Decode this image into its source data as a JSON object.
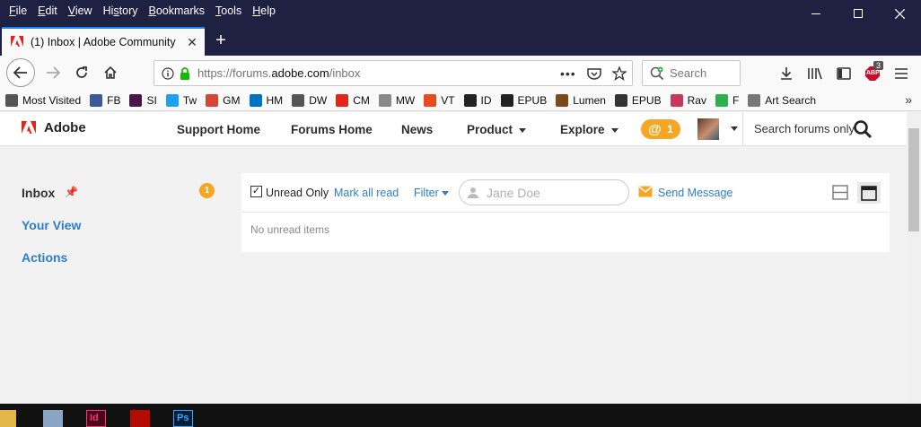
{
  "menu": [
    "File",
    "Edit",
    "View",
    "History",
    "Bookmarks",
    "Tools",
    "Help"
  ],
  "menu_underline": [
    "F",
    "E",
    "V",
    "s",
    "B",
    "T",
    "H"
  ],
  "tab": {
    "title": "(1) Inbox | Adobe Community"
  },
  "url": {
    "prefix": "https://forums.",
    "domain": "adobe.com",
    "path": "/inbox"
  },
  "search": {
    "placeholder": "Search"
  },
  "bookmarks": [
    {
      "label": "Most Visited",
      "icon": "gear-icon",
      "color": "#555555"
    },
    {
      "label": "FB",
      "icon": "facebook-icon",
      "color": "#3b5998"
    },
    {
      "label": "SI",
      "icon": "slack-icon",
      "color": "#4a154b"
    },
    {
      "label": "Tw",
      "icon": "twitter-icon",
      "color": "#1da1f2"
    },
    {
      "label": "GM",
      "icon": "gmail-icon",
      "color": "#d44638"
    },
    {
      "label": "HM",
      "icon": "outlook-icon",
      "color": "#0072c6"
    },
    {
      "label": "DW",
      "icon": "dw-icon",
      "color": "#555555"
    },
    {
      "label": "CM",
      "icon": "cm-icon",
      "color": "#e1251b"
    },
    {
      "label": "MW",
      "icon": "mw-icon",
      "color": "#888888"
    },
    {
      "label": "VT",
      "icon": "vt-icon",
      "color": "#e84c1e"
    },
    {
      "label": "ID",
      "icon": "id-icon",
      "color": "#222222"
    },
    {
      "label": "EPUB",
      "icon": "epub-icon",
      "color": "#222222"
    },
    {
      "label": "Lumen",
      "icon": "lumen-icon",
      "color": "#7a4a1e"
    },
    {
      "label": "EPUB",
      "icon": "epub2-icon",
      "color": "#333333"
    },
    {
      "label": "Rav",
      "icon": "rav-icon",
      "color": "#c8385a"
    },
    {
      "label": "F",
      "icon": "feedly-icon",
      "color": "#2bb24c"
    },
    {
      "label": "Art Search",
      "icon": "folder-icon",
      "color": "#777777"
    }
  ],
  "site": {
    "brand": "Adobe",
    "nav": [
      {
        "label": "Support Home",
        "dropdown": false
      },
      {
        "label": "Forums Home",
        "dropdown": false
      },
      {
        "label": "News",
        "dropdown": false
      },
      {
        "label": "Product",
        "dropdown": true
      },
      {
        "label": "Explore",
        "dropdown": true
      }
    ],
    "mentions_symbol": "@",
    "mentions_count": "1",
    "search_label": "Search forums only"
  },
  "sidebar": {
    "inbox": "Inbox",
    "inbox_count": "1",
    "your_view": "Your View",
    "actions": "Actions"
  },
  "inbox": {
    "unread_only": "Unread Only",
    "unread_checked": true,
    "mark_all_read": "Mark all read",
    "filter": "Filter",
    "user_placeholder": "Jane Doe",
    "send_message": "Send Message",
    "empty_text": "No unread items"
  },
  "addon_badge": "3",
  "addon_label": "ABP",
  "colors": {
    "titlebar": "#1f2142",
    "accent_blue": "#2d7ec4",
    "badge_orange": "#f5a623",
    "adobe_red": "#e1251b"
  }
}
